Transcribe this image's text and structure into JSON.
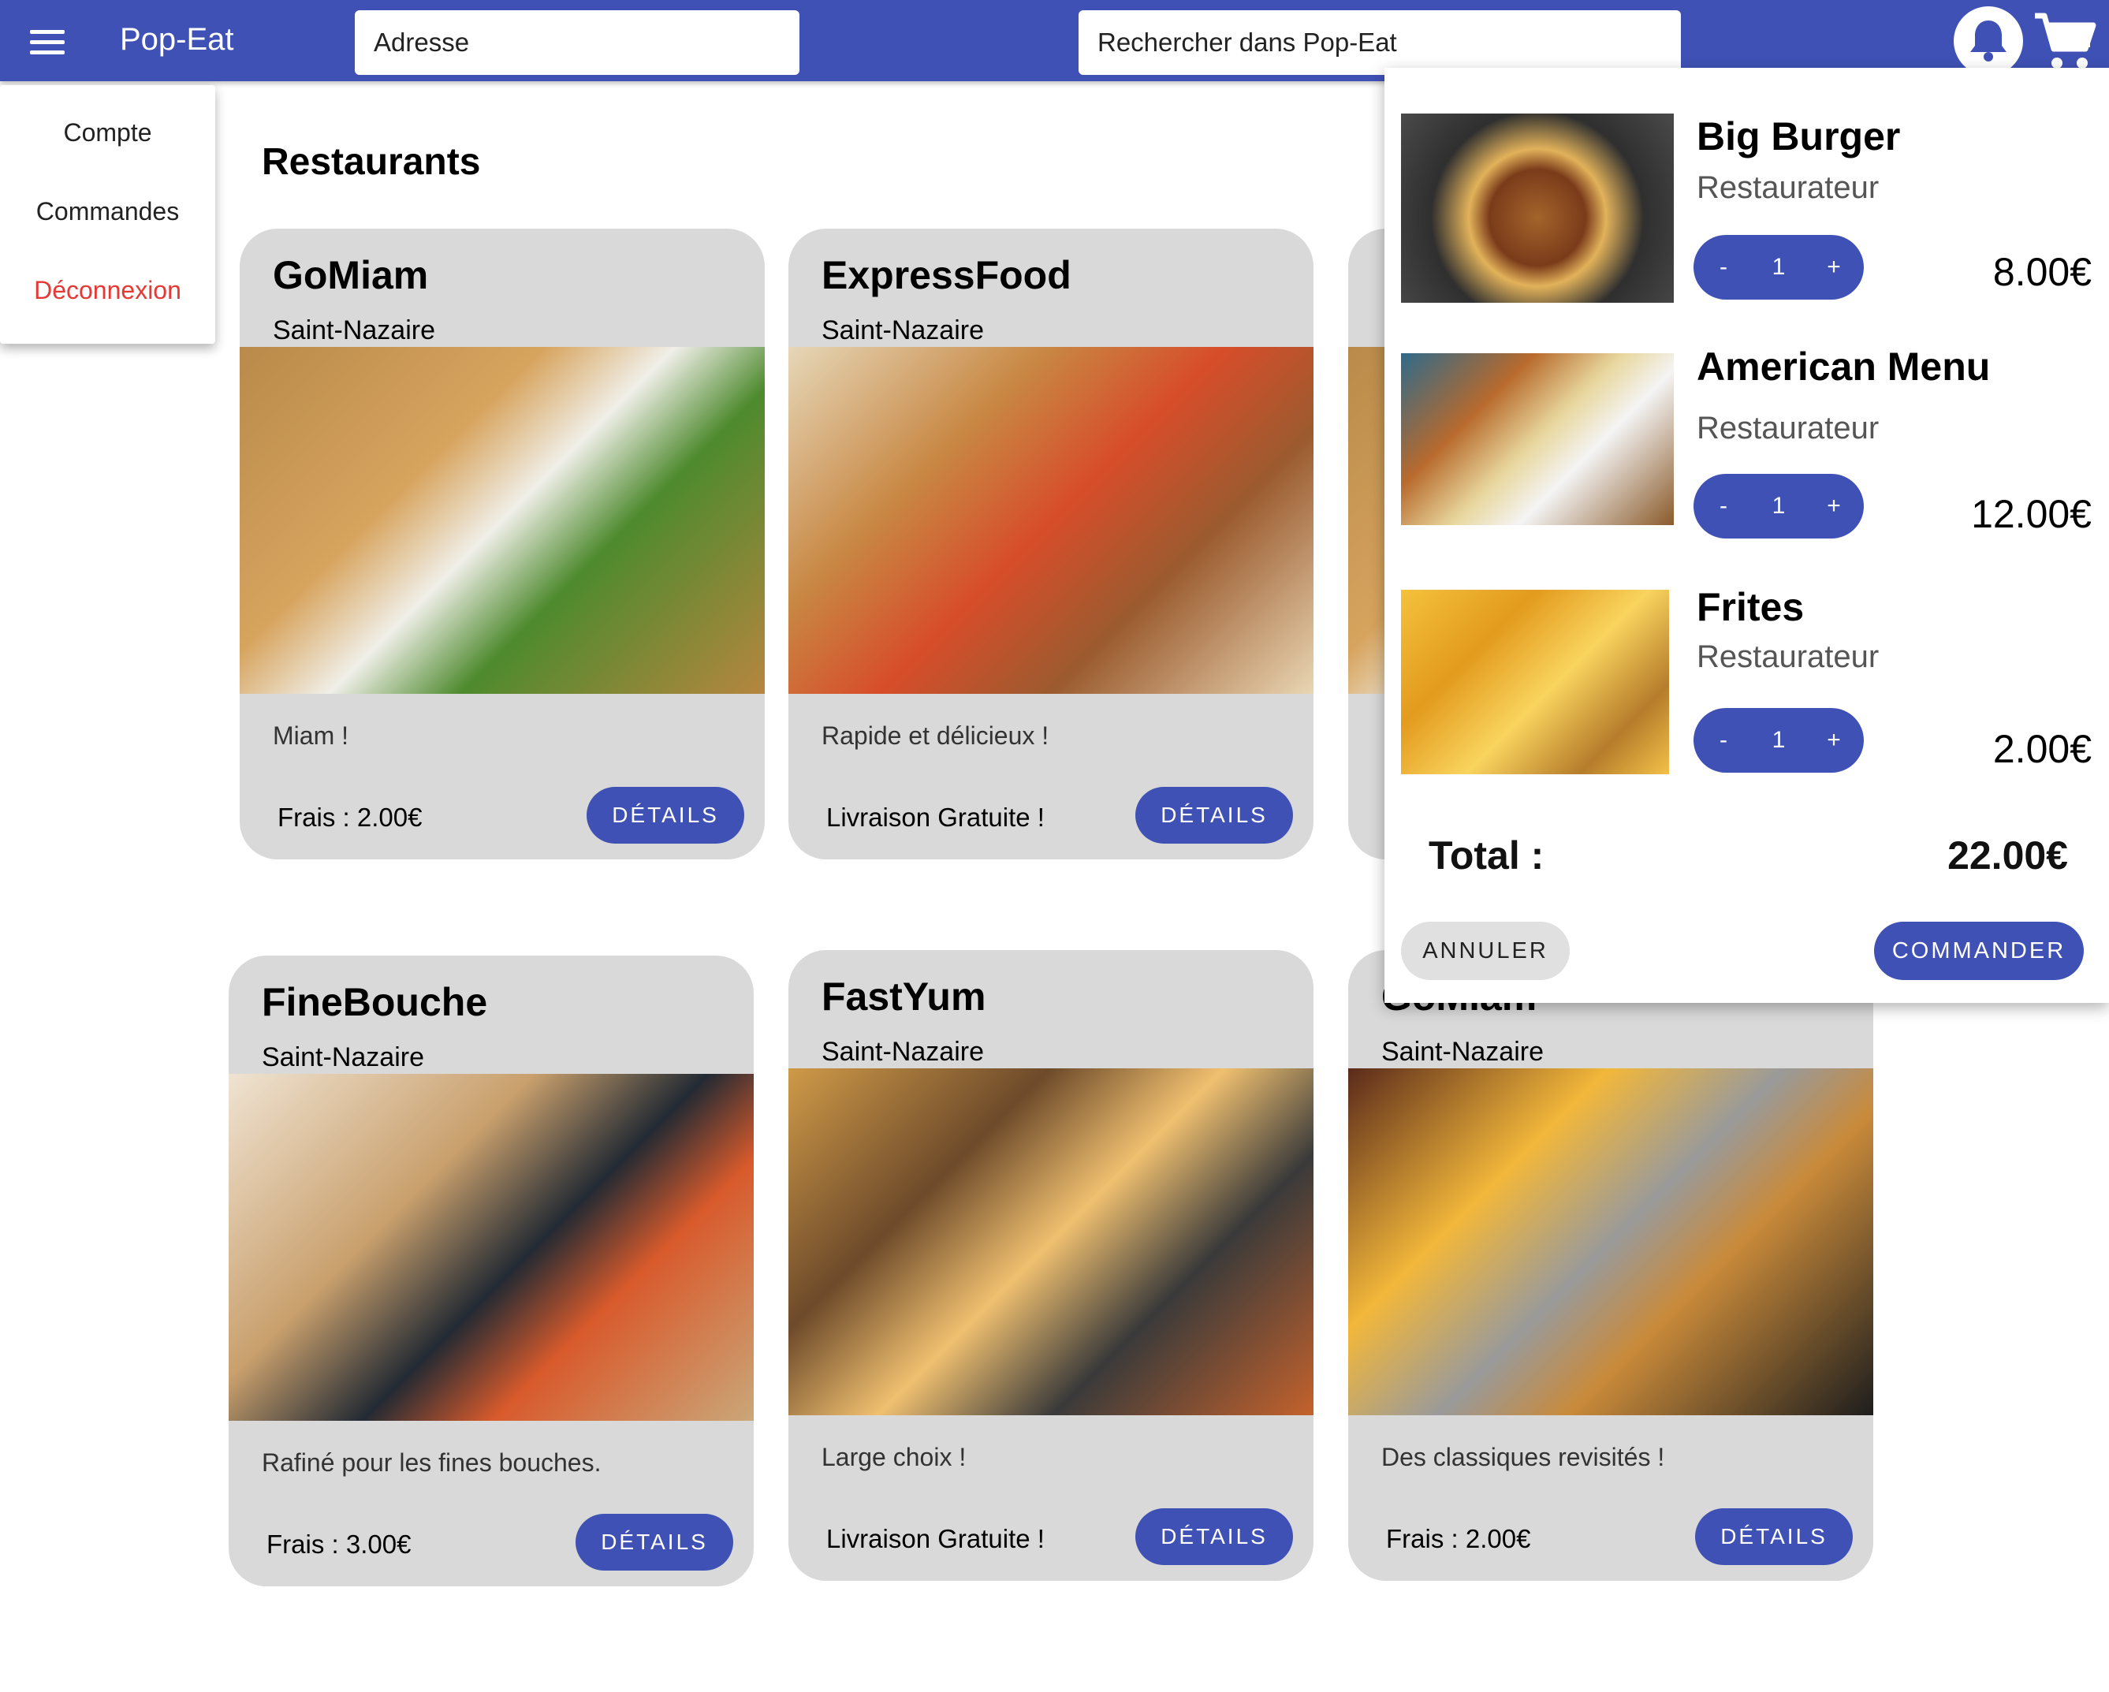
{
  "app": {
    "title": "Pop-Eat"
  },
  "header": {
    "address_placeholder": "Adresse",
    "search_placeholder": "Rechercher dans Pop-Eat"
  },
  "account_menu": {
    "items": [
      {
        "label": "Compte"
      },
      {
        "label": "Commandes"
      },
      {
        "label": "Déconnexion"
      }
    ]
  },
  "main": {
    "title": "Restaurants",
    "details_label": "DÉTAILS",
    "restaurants": [
      {
        "name": "GoMiam",
        "city": "Saint-Nazaire",
        "description": "Miam !",
        "fee": "Frais : 2.00€"
      },
      {
        "name": "ExpressFood",
        "city": "Saint-Nazaire",
        "description": "Rapide et délicieux !",
        "fee": "Livraison Gratuite !"
      },
      {
        "name": "FineBouche",
        "city": "Saint-Nazaire",
        "description": "Rafiné pour les fines bouches.",
        "fee": "Frais : 3.00€"
      },
      {
        "name": "FastYum",
        "city": "Saint-Nazaire",
        "description": "Large choix !",
        "fee": "Livraison Gratuite !"
      },
      {
        "name": "GoMiam",
        "city": "Saint-Nazaire",
        "description": "Des classiques revisités !",
        "fee": "Frais : 2.00€"
      }
    ]
  },
  "cart": {
    "items": [
      {
        "name": "Big Burger",
        "role": "Restaurateur",
        "quantity": "1",
        "price": "8.00€"
      },
      {
        "name": "American Menu",
        "role": "Restaurateur",
        "quantity": "1",
        "price": "12.00€"
      },
      {
        "name": "Frites",
        "role": "Restaurateur",
        "quantity": "1",
        "price": "2.00€"
      }
    ],
    "minus_label": "-",
    "plus_label": "+",
    "total_label": "Total :",
    "total_value": "22.00€",
    "cancel_label": "ANNULER",
    "order_label": "COMMANDER"
  },
  "colors": {
    "primary": "#3f51b5",
    "card_background": "#d9d9d9",
    "logout": "#e53935"
  },
  "icons": [
    "menu-icon",
    "bell-icon",
    "cart-icon"
  ]
}
